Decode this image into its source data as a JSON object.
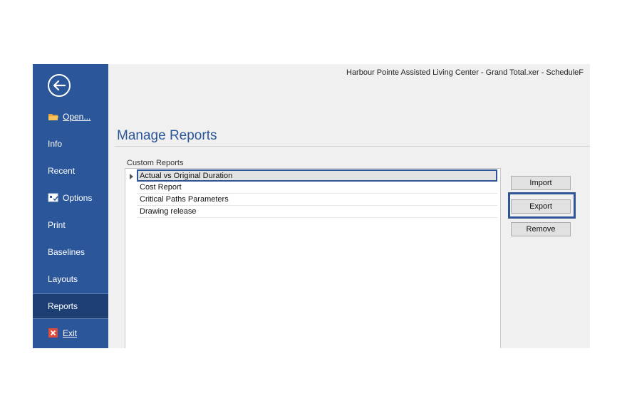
{
  "window": {
    "title": "Harbour Pointe Assisted Living Center - Grand Total.xer - ScheduleF"
  },
  "sidebar": {
    "back_icon": "back-arrow-icon",
    "items": [
      {
        "label": "Open...",
        "icon": "folder-icon"
      },
      {
        "label": "Info"
      },
      {
        "label": "Recent"
      },
      {
        "label": "Options",
        "icon": "options-icon"
      },
      {
        "label": "Print"
      },
      {
        "label": "Baselines"
      },
      {
        "label": "Layouts"
      },
      {
        "label": "Reports",
        "active": true
      },
      {
        "label": "Exit",
        "icon": "exit-icon"
      }
    ]
  },
  "main": {
    "heading": "Manage Reports",
    "section_label": "Custom Reports",
    "reports": [
      "Actual vs Original Duration",
      "Cost Report",
      "Critical Paths Parameters",
      "Drawing release"
    ],
    "selected_index": 0,
    "buttons": {
      "import": "Import",
      "export": "Export",
      "remove": "Remove"
    }
  },
  "colors": {
    "accent": "#2b579a",
    "active_nav": "#1e3f73",
    "highlight": "#2f5597"
  }
}
